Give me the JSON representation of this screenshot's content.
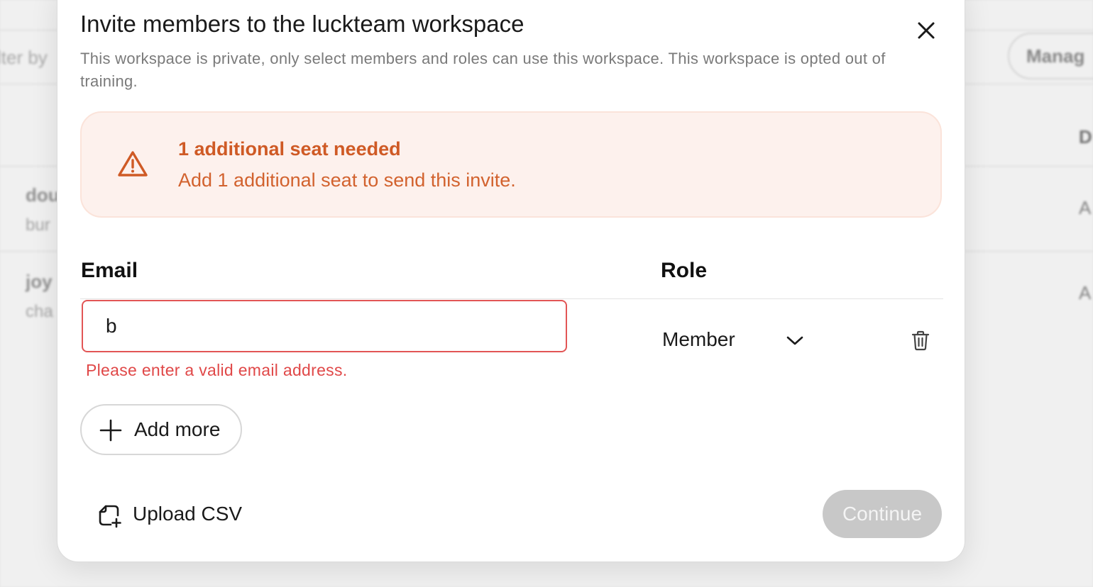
{
  "background": {
    "filter_placeholder": "lter by",
    "manage_button": "Manag",
    "column_header": "D",
    "rows": [
      {
        "name": "dou",
        "sub": "bur",
        "role": "A"
      },
      {
        "name": "joy",
        "sub": "cha",
        "role": "A"
      }
    ]
  },
  "modal": {
    "title": "Invite members to the luckteam workspace",
    "description": "This workspace is private, only select members and roles can use this workspace. This workspace is opted out of training.",
    "close_icon": "close-icon"
  },
  "banner": {
    "icon": "warning-triangle-icon",
    "title": "1 additional seat needed",
    "text": "Add 1 additional seat to send this invite.",
    "color": "#cf5a25",
    "background": "#fdf1ed"
  },
  "form": {
    "email_header": "Email",
    "role_header": "Role",
    "rows": [
      {
        "email_value": "b",
        "role_value": "Member",
        "error": "Please enter a valid email address."
      }
    ],
    "add_more_label": "Add more",
    "upload_csv_label": "Upload CSV",
    "continue_label": "Continue"
  },
  "colors": {
    "error": "#e04848",
    "continue_disabled": "#c8c8c8"
  }
}
